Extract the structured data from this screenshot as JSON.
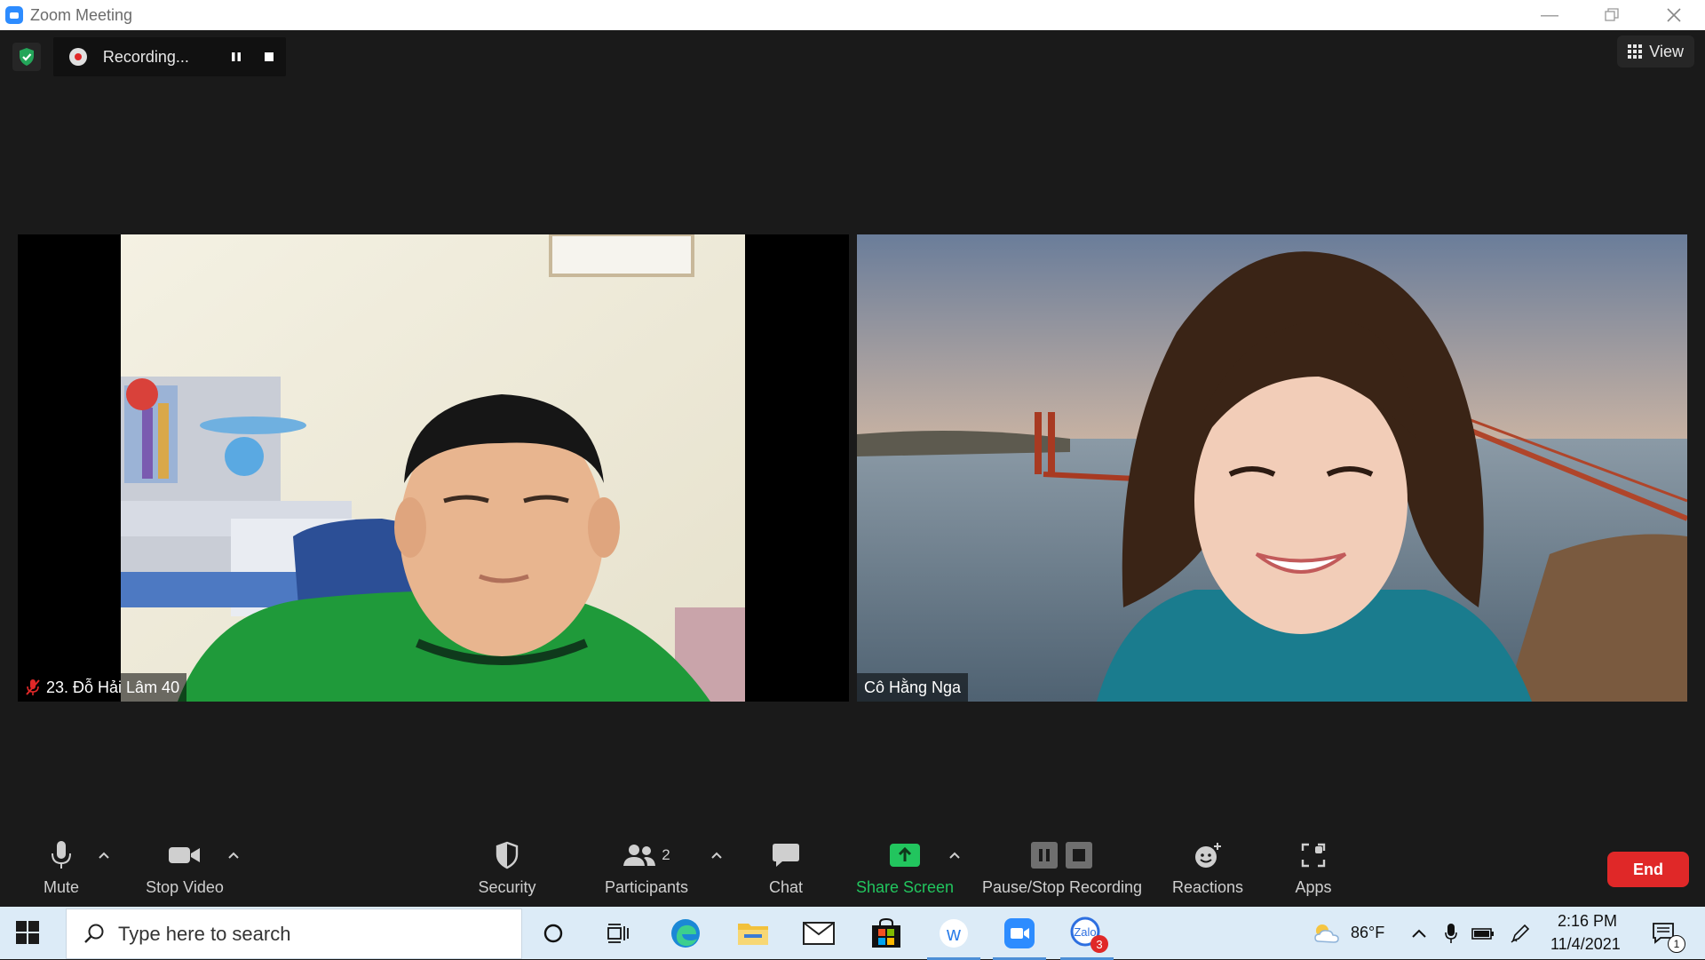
{
  "window": {
    "title": "Zoom Meeting"
  },
  "recording": {
    "status": "Recording..."
  },
  "view_button": {
    "label": "View"
  },
  "participants_tiles": [
    {
      "name": "23. Đỗ Hải Lâm 40",
      "muted": true
    },
    {
      "name": "Cô Hằng Nga",
      "muted": false
    }
  ],
  "toolbar": {
    "mute": "Mute",
    "stop_video": "Stop Video",
    "security": "Security",
    "participants": "Participants",
    "participants_count": "2",
    "chat": "Chat",
    "share_screen": "Share Screen",
    "pause_stop_recording": "Pause/Stop Recording",
    "reactions": "Reactions",
    "apps": "Apps",
    "end": "End"
  },
  "taskbar": {
    "search_placeholder": "Type here to search",
    "weather": "86°F",
    "time": "2:16 PM",
    "date": "11/4/2021",
    "zoom_badge": "3",
    "notification_count": "1"
  },
  "colors": {
    "background": "#1a1a1a",
    "share_green": "#22c55e",
    "end_red": "#e02828",
    "zoom_blue": "#2d8cff",
    "taskbar": "#dcebf7"
  }
}
